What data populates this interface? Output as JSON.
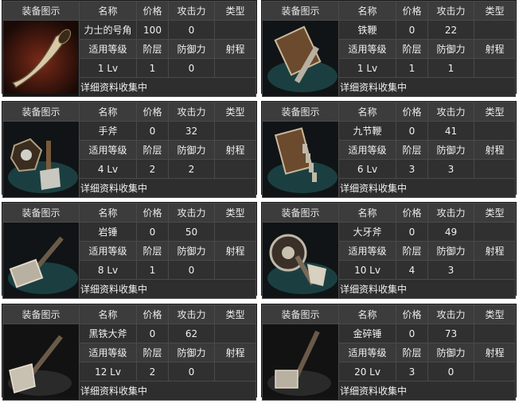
{
  "headers": {
    "icon": "装备图示",
    "name": "名称",
    "price": "价格",
    "attack": "攻击力",
    "type": "类型",
    "level": "适用等级",
    "tier": "阶层",
    "defense": "防御力",
    "range": "射程"
  },
  "items": [
    {
      "name": "力士的号角",
      "price": "100",
      "attack": "0",
      "type": "",
      "level": "1 Lv",
      "tier": "1",
      "defense": "0",
      "range": "",
      "note": "详细资料收集中",
      "icon": "horn-icon"
    },
    {
      "name": "铁鞭",
      "price": "0",
      "attack": "22",
      "type": "",
      "level": "1 Lv",
      "tier": "1",
      "defense": "1",
      "range": "",
      "note": "详细资料收集中",
      "icon": "iron-whip-icon"
    },
    {
      "name": "手斧",
      "price": "0",
      "attack": "32",
      "type": "",
      "level": "4 Lv",
      "tier": "2",
      "defense": "2",
      "range": "",
      "note": "详细资料收集中",
      "icon": "hand-axe-icon"
    },
    {
      "name": "九节鞭",
      "price": "0",
      "attack": "41",
      "type": "",
      "level": "6 Lv",
      "tier": "3",
      "defense": "3",
      "range": "",
      "note": "详细资料收集中",
      "icon": "nine-section-whip-icon"
    },
    {
      "name": "岩锤",
      "price": "0",
      "attack": "50",
      "type": "",
      "level": "8 Lv",
      "tier": "1",
      "defense": "0",
      "range": "",
      "note": "详细资料收集中",
      "icon": "rock-hammer-icon"
    },
    {
      "name": "大牙斧",
      "price": "0",
      "attack": "49",
      "type": "",
      "level": "10 Lv",
      "tier": "4",
      "defense": "3",
      "range": "",
      "note": "详细资料收集中",
      "icon": "fang-axe-icon"
    },
    {
      "name": "黑铁大斧",
      "price": "0",
      "attack": "62",
      "type": "",
      "level": "12 Lv",
      "tier": "2",
      "defense": "0",
      "range": "",
      "note": "详细资料收集中",
      "icon": "black-iron-axe-icon"
    },
    {
      "name": "金碎锤",
      "price": "0",
      "attack": "73",
      "type": "",
      "level": "20 Lv",
      "tier": "3",
      "defense": "0",
      "range": "",
      "note": "详细资料收集中",
      "icon": "gold-crusher-hammer-icon"
    }
  ]
}
